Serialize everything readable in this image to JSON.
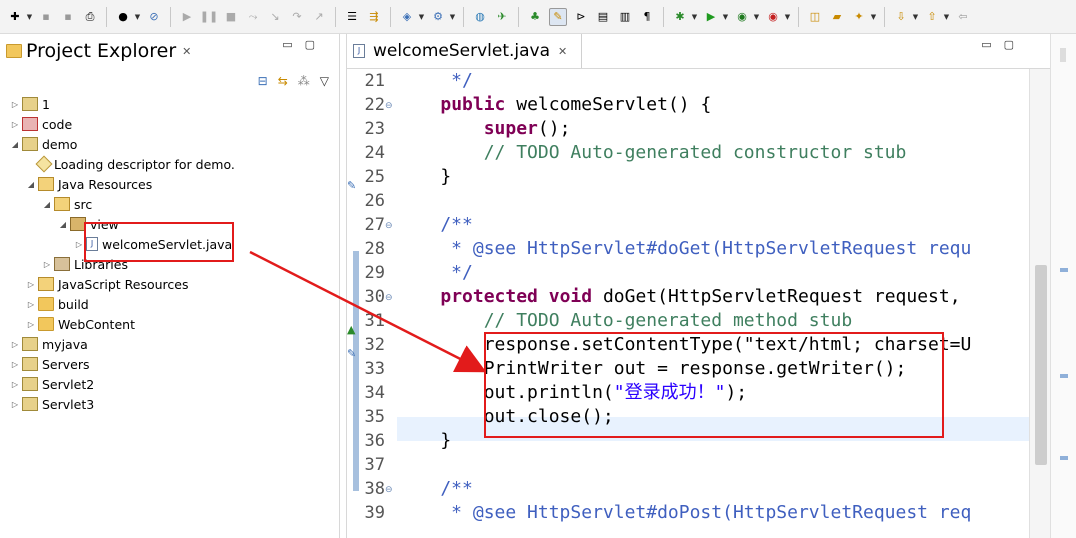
{
  "project_explorer": {
    "title": "Project Explorer",
    "close_glyph": "✕",
    "tree": [
      {
        "label": "1",
        "icon": "project-folder-icon",
        "expanded": false
      },
      {
        "label": "code",
        "icon": "project-error-icon",
        "expanded": false
      },
      {
        "label": "demo",
        "icon": "project-folder-icon",
        "expanded": true
      },
      {
        "label": "Loading descriptor for demo.",
        "icon": "descriptor-icon"
      },
      {
        "label": "Java Resources",
        "icon": "java-resources-icon",
        "expanded": true
      },
      {
        "label": "src",
        "icon": "source-folder-icon",
        "expanded": true
      },
      {
        "label": "view",
        "icon": "package-icon",
        "expanded": true
      },
      {
        "label": "welcomeServlet.java",
        "icon": "java-file-icon"
      },
      {
        "label": "Libraries",
        "icon": "libraries-icon",
        "expanded": false
      },
      {
        "label": "JavaScript Resources",
        "icon": "js-resources-icon",
        "expanded": false
      },
      {
        "label": "build",
        "icon": "folder-icon",
        "expanded": false
      },
      {
        "label": "WebContent",
        "icon": "folder-icon",
        "expanded": false
      },
      {
        "label": "myjava",
        "icon": "project-folder-icon",
        "expanded": false
      },
      {
        "label": "Servers",
        "icon": "project-folder-icon",
        "expanded": false
      },
      {
        "label": "Servlet2",
        "icon": "project-folder-icon",
        "expanded": false
      },
      {
        "label": "Servlet3",
        "icon": "project-folder-icon",
        "expanded": false
      }
    ]
  },
  "editor": {
    "tab_title": "welcomeServlet.java",
    "close_glyph": "✕",
    "lines": [
      {
        "num": "21",
        "text": "     */"
      },
      {
        "num": "22",
        "text": "    public welcomeServlet() {"
      },
      {
        "num": "23",
        "text": "        super();"
      },
      {
        "num": "24",
        "text": "        // TODO Auto-generated constructor stub"
      },
      {
        "num": "25",
        "text": "    }"
      },
      {
        "num": "26",
        "text": ""
      },
      {
        "num": "27",
        "text": "    /**"
      },
      {
        "num": "28",
        "text": "     * @see HttpServlet#doGet(HttpServletRequest requ"
      },
      {
        "num": "29",
        "text": "     */"
      },
      {
        "num": "30",
        "text": "    protected void doGet(HttpServletRequest request,"
      },
      {
        "num": "31",
        "text": "        // TODO Auto-generated method stub"
      },
      {
        "num": "32",
        "text": "        response.setContentType(\"text/html; charset=U"
      },
      {
        "num": "33",
        "text": "        PrintWriter out = response.getWriter();"
      },
      {
        "num": "34",
        "text": "        out.println(\"登录成功！\");"
      },
      {
        "num": "35",
        "text": "        out.close();"
      },
      {
        "num": "36",
        "text": "    }"
      },
      {
        "num": "37",
        "text": ""
      },
      {
        "num": "38",
        "text": "    /**"
      },
      {
        "num": "39",
        "text": "     * @see HttpServlet#doPost(HttpServletRequest req"
      }
    ]
  },
  "colors": {
    "keyword": "#7f0055",
    "comment": "#3f7f5f",
    "javadoc": "#3f5fbf",
    "string": "#2a00ff",
    "annotation_red": "#e21b1b"
  }
}
